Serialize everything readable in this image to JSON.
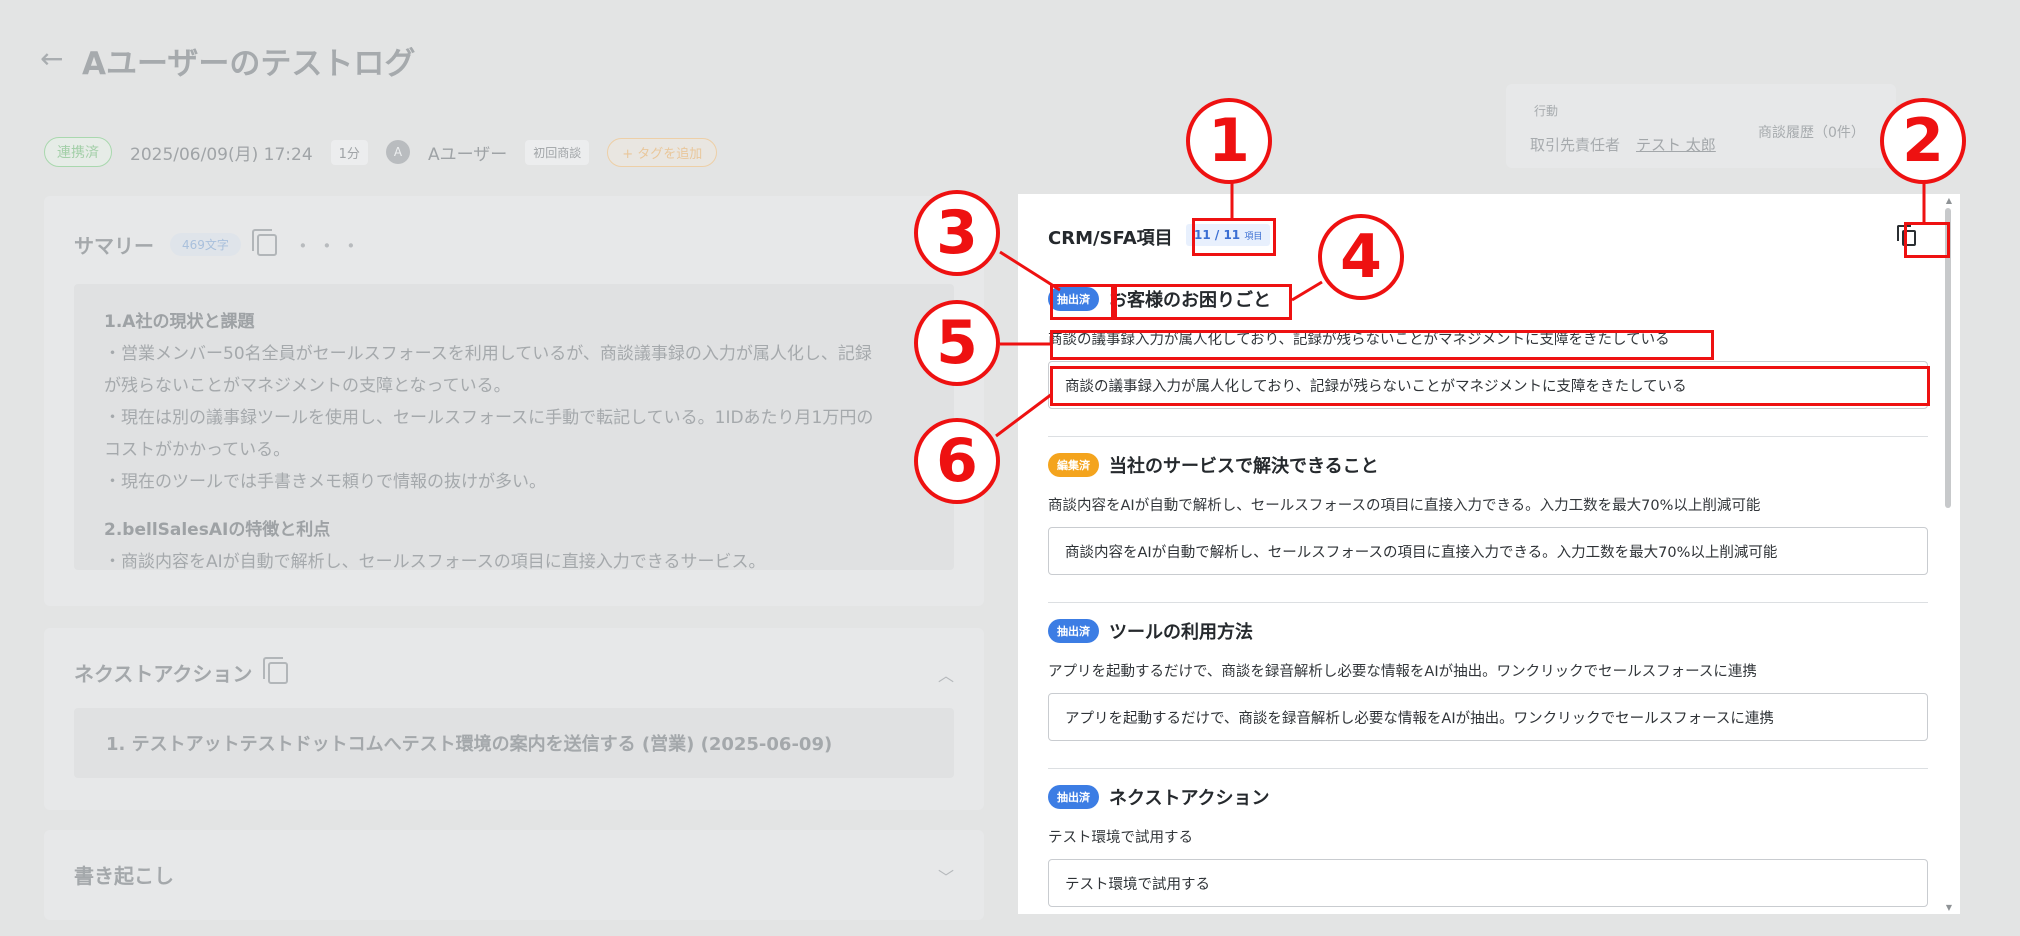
{
  "header": {
    "back_icon": "←",
    "title": "Aユーザーのテストログ"
  },
  "meta": {
    "linked_status": "連携済",
    "datetime": "2025/06/09(月) 17:24",
    "duration": "1分",
    "avatar_initial": "A",
    "user": "Aユーザー",
    "tag": "初回商談",
    "add_tag": "+ タグを追加"
  },
  "action": {
    "label": "行動",
    "owner_label": "取引先責任者",
    "owner_name": "テスト 太郎",
    "history": "商談履歴（0件）"
  },
  "summary": {
    "title": "サマリー",
    "char_count": "469文字",
    "more": "・・・",
    "lines": [
      {
        "text": "1.A社の現状と課題",
        "heading": true
      },
      {
        "text": "・営業メンバー50名全員がセールスフォースを利用しているが、商談議事録の入力が属人化し、記録",
        "heading": false
      },
      {
        "text": "が残らないことがマネジメントの支障となっている。",
        "heading": false
      },
      {
        "text": "・現在は別の議事録ツールを使用し、セールスフォースに手動で転記している。1IDあたり月1万円の",
        "heading": false
      },
      {
        "text": "コストがかかっている。",
        "heading": false
      },
      {
        "text": "・現在のツールでは手書きメモ頼りで情報の抜けが多い。",
        "heading": false
      },
      {
        "text": "2.bellSalesAIの特徴と利点",
        "heading": true
      },
      {
        "text": "・商談内容をAIが自動で解析し、セールスフォースの項目に直接入力できるサービス。",
        "heading": false
      }
    ]
  },
  "next_action": {
    "title": "ネクストアクション",
    "item": "1. テストアットテストドットコムへテスト環境の案内を送信する (営業) (2025-06-09)"
  },
  "transcript": {
    "title": "書き起こし"
  },
  "crm": {
    "title": "CRM/SFA項目",
    "count": "11 / 11",
    "count_unit": "項目",
    "items": [
      {
        "status": "抽出済",
        "status_type": "extracted",
        "title": "お客様のお困りごと",
        "description": "商談の議事録入力が属人化しており、記録が残らないことがマネジメントに支障をきたしている",
        "value": "商談の議事録入力が属人化しており、記録が残らないことがマネジメントに支障をきたしている"
      },
      {
        "status": "編集済",
        "status_type": "edited",
        "title": "当社のサービスで解決できること",
        "description": "商談内容をAIが自動で解析し、セールスフォースの項目に直接入力できる。入力工数を最大70%以上削減可能",
        "value": "商談内容をAIが自動で解析し、セールスフォースの項目に直接入力できる。入力工数を最大70%以上削減可能"
      },
      {
        "status": "抽出済",
        "status_type": "extracted",
        "title": "ツールの利用方法",
        "description": "アプリを起動するだけで、商談を録音解析し必要な情報をAIが抽出。ワンクリックでセールスフォースに連携",
        "value": "アプリを起動するだけで、商談を録音解析し必要な情報をAIが抽出。ワンクリックでセールスフォースに連携"
      },
      {
        "status": "抽出済",
        "status_type": "extracted",
        "title": "ネクストアクション",
        "description": "テスト環境で試用する",
        "value": "テスト環境で試用する"
      }
    ]
  },
  "annotations": [
    "1",
    "2",
    "3",
    "4",
    "5",
    "6"
  ],
  "colors": {
    "annotation_red": "#ee1111",
    "extracted_blue": "#3c7de4",
    "edited_orange": "#f4a41d"
  }
}
